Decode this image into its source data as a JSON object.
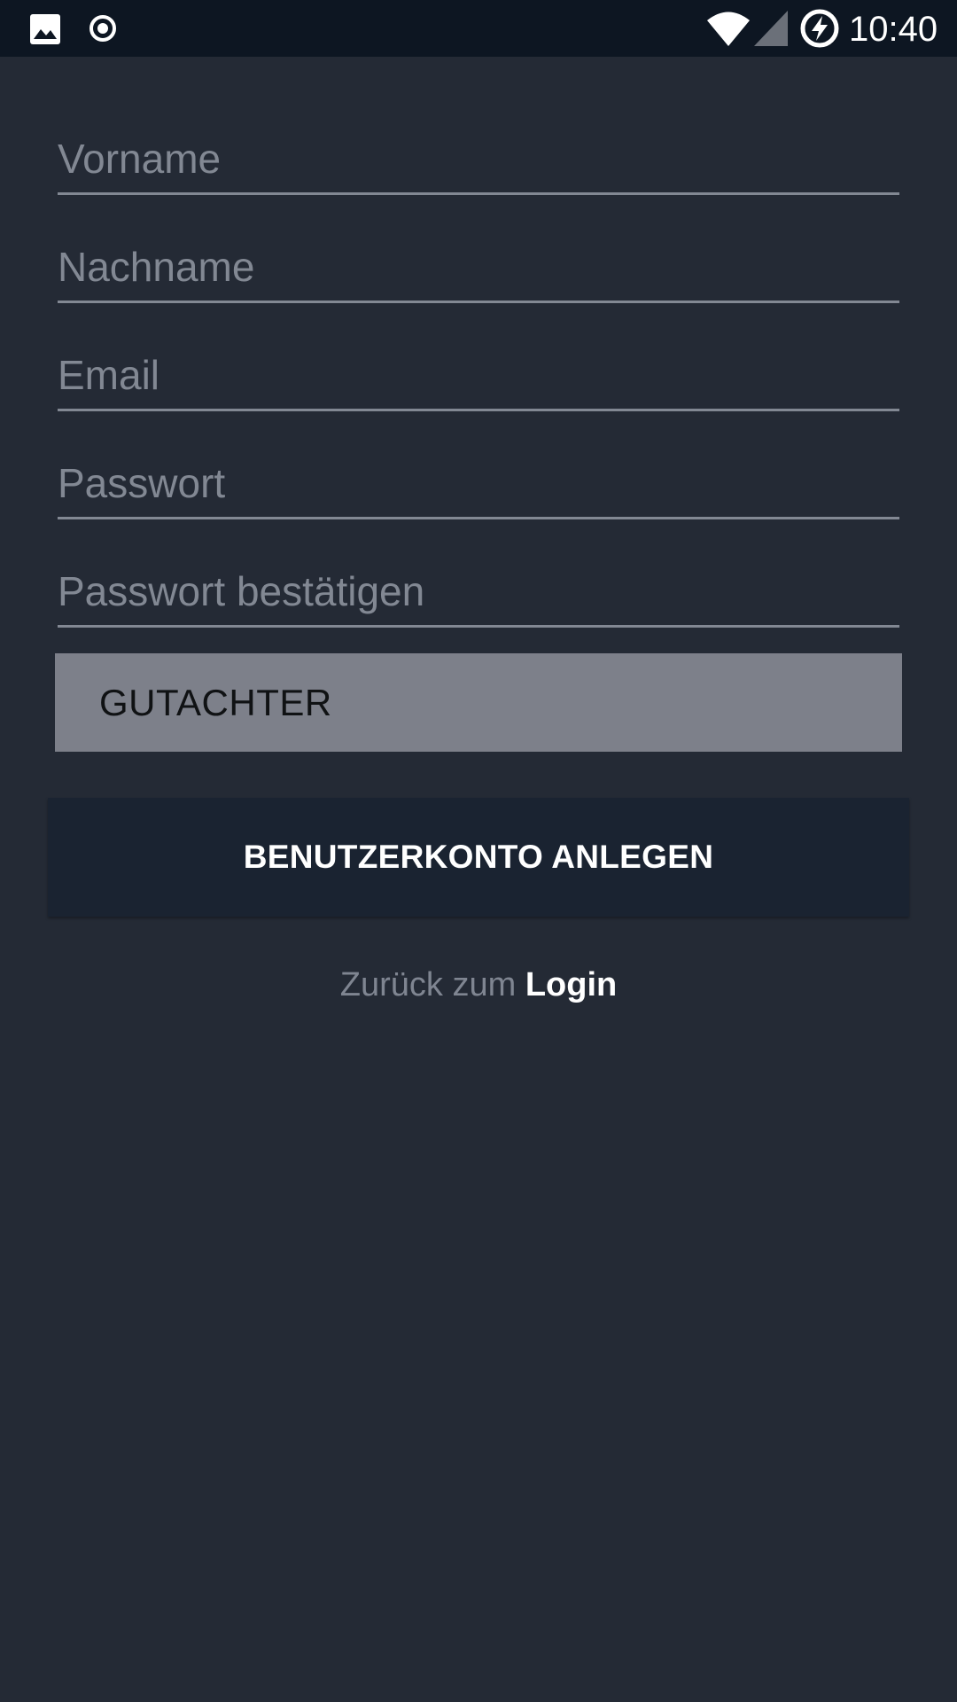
{
  "status_bar": {
    "time": "10:40",
    "icons": [
      "image-icon",
      "record-icon",
      "wifi-icon",
      "signal-icon",
      "battery-charging-icon"
    ]
  },
  "form": {
    "first_name": {
      "value": "",
      "placeholder": "Vorname"
    },
    "last_name": {
      "value": "",
      "placeholder": "Nachname"
    },
    "email": {
      "value": "",
      "placeholder": "Email"
    },
    "password": {
      "value": "",
      "placeholder": "Passwort"
    },
    "password_confirm": {
      "value": "",
      "placeholder": "Passwort bestätigen"
    },
    "role": {
      "selected": "GUTACHTER"
    }
  },
  "actions": {
    "create_account_label": "BENUTZERKONTO ANLEGEN",
    "back_prefix": "Zurück zum",
    "back_link": "Login"
  },
  "colors": {
    "background": "#242a35",
    "status_bar": "#0d1622",
    "field_line": "#828893",
    "role_box": "#7d808a",
    "button": "#1a2331",
    "muted_text": "#7f8591"
  }
}
